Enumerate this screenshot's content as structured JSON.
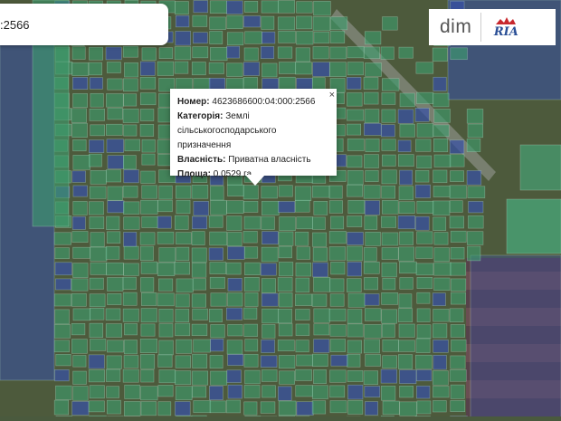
{
  "search": {
    "value": ":2566"
  },
  "logo": {
    "brand": "dim",
    "brand_sub": "RIA"
  },
  "popup": {
    "close_label": "×",
    "number_label": "Номер:",
    "number_value": "4623686600:04:000:2566",
    "category_label": "Категорія:",
    "category_value_1": "Землі",
    "category_value_2": "сільськогосподарського призначення",
    "ownership_label": "Власність:",
    "ownership_value": "Приватна власність",
    "area_label": "Площа:",
    "area_value": "0.0529 га"
  },
  "colors": {
    "parcel_green": "#3d9c6e",
    "parcel_blue": "#3650a8",
    "brand_blue": "#2a4f96"
  },
  "icons": [
    "close-icon",
    "ria-logo-icon"
  ]
}
